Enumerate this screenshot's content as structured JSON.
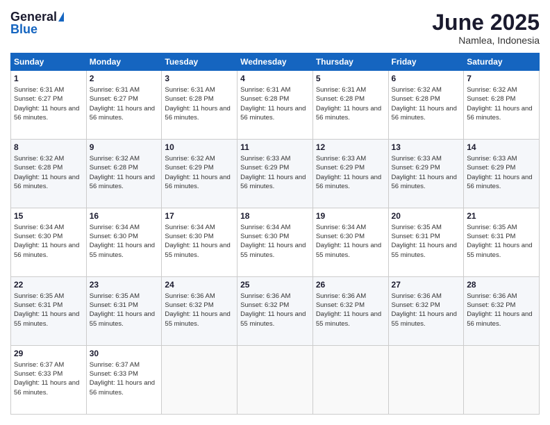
{
  "logo": {
    "general": "General",
    "blue": "Blue"
  },
  "title": {
    "month_year": "June 2025",
    "location": "Namlea, Indonesia"
  },
  "days_header": [
    "Sunday",
    "Monday",
    "Tuesday",
    "Wednesday",
    "Thursday",
    "Friday",
    "Saturday"
  ],
  "weeks": [
    [
      {
        "day": "1",
        "sunrise": "Sunrise: 6:31 AM",
        "sunset": "Sunset: 6:27 PM",
        "daylight": "Daylight: 11 hours and 56 minutes."
      },
      {
        "day": "2",
        "sunrise": "Sunrise: 6:31 AM",
        "sunset": "Sunset: 6:27 PM",
        "daylight": "Daylight: 11 hours and 56 minutes."
      },
      {
        "day": "3",
        "sunrise": "Sunrise: 6:31 AM",
        "sunset": "Sunset: 6:28 PM",
        "daylight": "Daylight: 11 hours and 56 minutes."
      },
      {
        "day": "4",
        "sunrise": "Sunrise: 6:31 AM",
        "sunset": "Sunset: 6:28 PM",
        "daylight": "Daylight: 11 hours and 56 minutes."
      },
      {
        "day": "5",
        "sunrise": "Sunrise: 6:31 AM",
        "sunset": "Sunset: 6:28 PM",
        "daylight": "Daylight: 11 hours and 56 minutes."
      },
      {
        "day": "6",
        "sunrise": "Sunrise: 6:32 AM",
        "sunset": "Sunset: 6:28 PM",
        "daylight": "Daylight: 11 hours and 56 minutes."
      },
      {
        "day": "7",
        "sunrise": "Sunrise: 6:32 AM",
        "sunset": "Sunset: 6:28 PM",
        "daylight": "Daylight: 11 hours and 56 minutes."
      }
    ],
    [
      {
        "day": "8",
        "sunrise": "Sunrise: 6:32 AM",
        "sunset": "Sunset: 6:28 PM",
        "daylight": "Daylight: 11 hours and 56 minutes."
      },
      {
        "day": "9",
        "sunrise": "Sunrise: 6:32 AM",
        "sunset": "Sunset: 6:28 PM",
        "daylight": "Daylight: 11 hours and 56 minutes."
      },
      {
        "day": "10",
        "sunrise": "Sunrise: 6:32 AM",
        "sunset": "Sunset: 6:29 PM",
        "daylight": "Daylight: 11 hours and 56 minutes."
      },
      {
        "day": "11",
        "sunrise": "Sunrise: 6:33 AM",
        "sunset": "Sunset: 6:29 PM",
        "daylight": "Daylight: 11 hours and 56 minutes."
      },
      {
        "day": "12",
        "sunrise": "Sunrise: 6:33 AM",
        "sunset": "Sunset: 6:29 PM",
        "daylight": "Daylight: 11 hours and 56 minutes."
      },
      {
        "day": "13",
        "sunrise": "Sunrise: 6:33 AM",
        "sunset": "Sunset: 6:29 PM",
        "daylight": "Daylight: 11 hours and 56 minutes."
      },
      {
        "day": "14",
        "sunrise": "Sunrise: 6:33 AM",
        "sunset": "Sunset: 6:29 PM",
        "daylight": "Daylight: 11 hours and 56 minutes."
      }
    ],
    [
      {
        "day": "15",
        "sunrise": "Sunrise: 6:34 AM",
        "sunset": "Sunset: 6:30 PM",
        "daylight": "Daylight: 11 hours and 56 minutes."
      },
      {
        "day": "16",
        "sunrise": "Sunrise: 6:34 AM",
        "sunset": "Sunset: 6:30 PM",
        "daylight": "Daylight: 11 hours and 55 minutes."
      },
      {
        "day": "17",
        "sunrise": "Sunrise: 6:34 AM",
        "sunset": "Sunset: 6:30 PM",
        "daylight": "Daylight: 11 hours and 55 minutes."
      },
      {
        "day": "18",
        "sunrise": "Sunrise: 6:34 AM",
        "sunset": "Sunset: 6:30 PM",
        "daylight": "Daylight: 11 hours and 55 minutes."
      },
      {
        "day": "19",
        "sunrise": "Sunrise: 6:34 AM",
        "sunset": "Sunset: 6:30 PM",
        "daylight": "Daylight: 11 hours and 55 minutes."
      },
      {
        "day": "20",
        "sunrise": "Sunrise: 6:35 AM",
        "sunset": "Sunset: 6:31 PM",
        "daylight": "Daylight: 11 hours and 55 minutes."
      },
      {
        "day": "21",
        "sunrise": "Sunrise: 6:35 AM",
        "sunset": "Sunset: 6:31 PM",
        "daylight": "Daylight: 11 hours and 55 minutes."
      }
    ],
    [
      {
        "day": "22",
        "sunrise": "Sunrise: 6:35 AM",
        "sunset": "Sunset: 6:31 PM",
        "daylight": "Daylight: 11 hours and 55 minutes."
      },
      {
        "day": "23",
        "sunrise": "Sunrise: 6:35 AM",
        "sunset": "Sunset: 6:31 PM",
        "daylight": "Daylight: 11 hours and 55 minutes."
      },
      {
        "day": "24",
        "sunrise": "Sunrise: 6:36 AM",
        "sunset": "Sunset: 6:32 PM",
        "daylight": "Daylight: 11 hours and 55 minutes."
      },
      {
        "day": "25",
        "sunrise": "Sunrise: 6:36 AM",
        "sunset": "Sunset: 6:32 PM",
        "daylight": "Daylight: 11 hours and 55 minutes."
      },
      {
        "day": "26",
        "sunrise": "Sunrise: 6:36 AM",
        "sunset": "Sunset: 6:32 PM",
        "daylight": "Daylight: 11 hours and 55 minutes."
      },
      {
        "day": "27",
        "sunrise": "Sunrise: 6:36 AM",
        "sunset": "Sunset: 6:32 PM",
        "daylight": "Daylight: 11 hours and 55 minutes."
      },
      {
        "day": "28",
        "sunrise": "Sunrise: 6:36 AM",
        "sunset": "Sunset: 6:32 PM",
        "daylight": "Daylight: 11 hours and 56 minutes."
      }
    ],
    [
      {
        "day": "29",
        "sunrise": "Sunrise: 6:37 AM",
        "sunset": "Sunset: 6:33 PM",
        "daylight": "Daylight: 11 hours and 56 minutes."
      },
      {
        "day": "30",
        "sunrise": "Sunrise: 6:37 AM",
        "sunset": "Sunset: 6:33 PM",
        "daylight": "Daylight: 11 hours and 56 minutes."
      },
      null,
      null,
      null,
      null,
      null
    ]
  ]
}
